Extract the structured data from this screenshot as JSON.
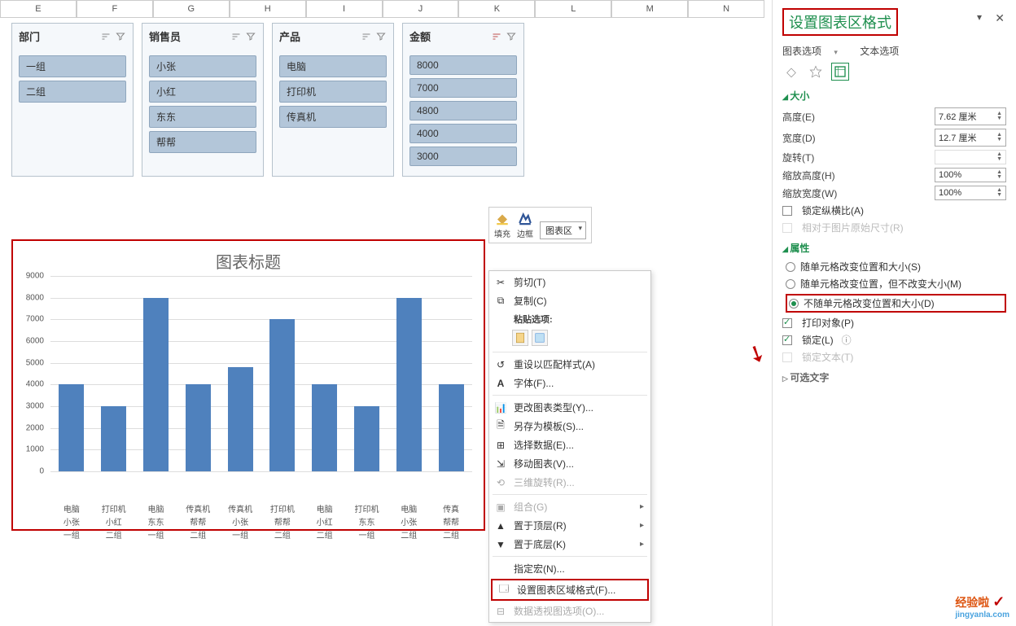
{
  "columns": [
    "E",
    "F",
    "G",
    "H",
    "I",
    "J",
    "K",
    "L",
    "M",
    "N"
  ],
  "slicers": [
    {
      "title": "部门",
      "items": [
        "一组",
        "二组"
      ]
    },
    {
      "title": "销售员",
      "items": [
        "小张",
        "小红",
        "东东",
        "帮帮"
      ]
    },
    {
      "title": "产品",
      "items": [
        "电脑",
        "打印机",
        "传真机"
      ]
    },
    {
      "title": "金额",
      "items": [
        "8000",
        "7000",
        "4800",
        "4000",
        "3000"
      ]
    }
  ],
  "mini_toolbar": {
    "fill": "填充",
    "outline": "边框",
    "select": "图表区"
  },
  "context_menu": {
    "cut": "剪切(T)",
    "copy": "复制(C)",
    "paste_label": "粘贴选项:",
    "reset": "重设以匹配样式(A)",
    "font": "字体(F)...",
    "change_type": "更改图表类型(Y)...",
    "save_tpl": "另存为模板(S)...",
    "select_data": "选择数据(E)...",
    "move_chart": "移动图表(V)...",
    "rotate3d": "三维旋转(R)...",
    "group": "组合(G)",
    "to_front": "置于顶层(R)",
    "to_back": "置于底层(K)",
    "assign_macro": "指定宏(N)...",
    "format_area": "设置图表区域格式(F)...",
    "pivot_opts": "数据透视图选项(O)..."
  },
  "pane": {
    "title": "设置图表区格式",
    "tab_chart": "图表选项",
    "tab_text": "文本选项",
    "section_size": "大小",
    "height_label": "高度(E)",
    "height_val": "7.62 厘米",
    "width_label": "宽度(D)",
    "width_val": "12.7 厘米",
    "rotate_label": "旋转(T)",
    "scale_h_label": "缩放高度(H)",
    "scale_h_val": "100%",
    "scale_w_label": "缩放宽度(W)",
    "scale_w_val": "100%",
    "lock_ratio": "锁定纵横比(A)",
    "rel_orig": "相对于图片原始尺寸(R)",
    "section_props": "属性",
    "opt1": "随单元格改变位置和大小(S)",
    "opt2": "随单元格改变位置，但不改变大小(M)",
    "opt3": "不随单元格改变位置和大小(D)",
    "print": "打印对象(P)",
    "locked": "锁定(L)",
    "lock_text": "锁定文本(T)",
    "section_alt": "可选文字"
  },
  "chart_data": {
    "type": "bar",
    "title": "图表标题",
    "ylim": [
      0,
      9000
    ],
    "yticks": [
      0,
      1000,
      2000,
      3000,
      4000,
      5000,
      6000,
      7000,
      8000,
      9000
    ],
    "categories": [
      {
        "prod": "电脑",
        "sales": "小张",
        "dept": "一组",
        "v": 4000
      },
      {
        "prod": "打印机",
        "sales": "小红",
        "dept": "二组",
        "v": 3000
      },
      {
        "prod": "电脑",
        "sales": "东东",
        "dept": "一组",
        "v": 8000
      },
      {
        "prod": "传真机",
        "sales": "帮帮",
        "dept": "二组",
        "v": 4000
      },
      {
        "prod": "传真机",
        "sales": "小张",
        "dept": "一组",
        "v": 4800
      },
      {
        "prod": "打印机",
        "sales": "帮帮",
        "dept": "二组",
        "v": 7000
      },
      {
        "prod": "电脑",
        "sales": "小红",
        "dept": "二组",
        "v": 4000
      },
      {
        "prod": "打印机",
        "sales": "东东",
        "dept": "一组",
        "v": 3000
      },
      {
        "prod": "电脑",
        "sales": "小张",
        "dept": "二组",
        "v": 8000
      },
      {
        "prod": "传真",
        "sales": "帮帮",
        "dept": "二组",
        "v": 4000
      }
    ]
  },
  "watermark": {
    "brand": "经验啦",
    "check": "✓",
    "url": "jingyanla.com"
  }
}
